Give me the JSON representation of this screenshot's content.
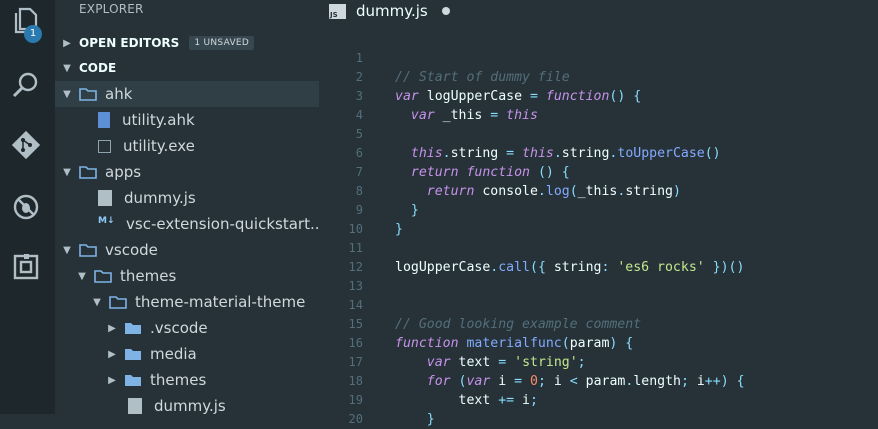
{
  "activity_bar": {
    "icons": [
      "files-icon",
      "search-icon",
      "git-icon",
      "debug-icon",
      "extensions-icon"
    ],
    "badge": "1"
  },
  "sidebar": {
    "title": "EXPLORER",
    "open_editors": {
      "label": "OPEN EDITORS",
      "badge": "1 UNSAVED"
    },
    "workspace": "CODE",
    "tree": [
      {
        "label": "ahk",
        "kind": "folder",
        "depth": 1,
        "open": true,
        "selected": true
      },
      {
        "label": "utility.ahk",
        "kind": "file-ahk",
        "depth": 2
      },
      {
        "label": "utility.exe",
        "kind": "file-exe",
        "depth": 2
      },
      {
        "label": "apps",
        "kind": "folder",
        "depth": 1,
        "open": true
      },
      {
        "label": "dummy.js",
        "kind": "file-js",
        "depth": 2
      },
      {
        "label": "vsc-extension-quickstart....",
        "kind": "file-md",
        "depth": 2
      },
      {
        "label": "vscode",
        "kind": "folder",
        "depth": 1,
        "open": true
      },
      {
        "label": "themes",
        "kind": "folder",
        "depth": 2,
        "open": true
      },
      {
        "label": "theme-material-theme",
        "kind": "folder",
        "depth": 3,
        "open": true
      },
      {
        "label": ".vscode",
        "kind": "folder-collapsed",
        "depth": 4
      },
      {
        "label": "media",
        "kind": "folder-collapsed",
        "depth": 4
      },
      {
        "label": "themes",
        "kind": "folder-collapsed",
        "depth": 4
      },
      {
        "label": "dummy.js",
        "kind": "file-js",
        "depth": 4
      }
    ]
  },
  "editor": {
    "tab": {
      "filename": "dummy.js",
      "icon_text": "JS",
      "dirty": true
    },
    "lines": [
      {
        "n": "1",
        "tokens": []
      },
      {
        "n": "2",
        "tokens": [
          {
            "t": "// Start of dummy file",
            "c": "comment"
          }
        ]
      },
      {
        "n": "3",
        "tokens": [
          {
            "t": "var ",
            "c": "keyword"
          },
          {
            "t": "logUpperCase",
            "c": "var"
          },
          {
            "t": " = ",
            "c": "op"
          },
          {
            "t": "function",
            "c": "keyword"
          },
          {
            "t": "() {",
            "c": "punct"
          }
        ]
      },
      {
        "n": "4",
        "tokens": [
          {
            "t": "  var ",
            "c": "keyword"
          },
          {
            "t": "_this",
            "c": "var"
          },
          {
            "t": " = ",
            "c": "op"
          },
          {
            "t": "this",
            "c": "keyword"
          }
        ]
      },
      {
        "n": "5",
        "tokens": []
      },
      {
        "n": "6",
        "tokens": [
          {
            "t": "  this",
            "c": "keyword"
          },
          {
            "t": ".",
            "c": "punct"
          },
          {
            "t": "string",
            "c": "var"
          },
          {
            "t": " = ",
            "c": "op"
          },
          {
            "t": "this",
            "c": "keyword"
          },
          {
            "t": ".",
            "c": "punct"
          },
          {
            "t": "string",
            "c": "var"
          },
          {
            "t": ".",
            "c": "punct"
          },
          {
            "t": "toUpperCase",
            "c": "func"
          },
          {
            "t": "()",
            "c": "punct"
          }
        ]
      },
      {
        "n": "7",
        "tokens": [
          {
            "t": "  return ",
            "c": "keyword"
          },
          {
            "t": "function ",
            "c": "keyword"
          },
          {
            "t": "() {",
            "c": "punct"
          }
        ]
      },
      {
        "n": "8",
        "tokens": [
          {
            "t": "    return ",
            "c": "keyword"
          },
          {
            "t": "console",
            "c": "var"
          },
          {
            "t": ".",
            "c": "punct"
          },
          {
            "t": "log",
            "c": "func"
          },
          {
            "t": "(",
            "c": "punct"
          },
          {
            "t": "_this",
            "c": "var"
          },
          {
            "t": ".",
            "c": "punct"
          },
          {
            "t": "string",
            "c": "var"
          },
          {
            "t": ")",
            "c": "punct"
          }
        ]
      },
      {
        "n": "9",
        "tokens": [
          {
            "t": "  }",
            "c": "punct"
          }
        ]
      },
      {
        "n": "10",
        "tokens": [
          {
            "t": "}",
            "c": "punct"
          }
        ]
      },
      {
        "n": "11",
        "tokens": []
      },
      {
        "n": "12",
        "tokens": [
          {
            "t": "logUpperCase",
            "c": "var"
          },
          {
            "t": ".",
            "c": "punct"
          },
          {
            "t": "call",
            "c": "func"
          },
          {
            "t": "({ ",
            "c": "punct"
          },
          {
            "t": "string",
            "c": "var"
          },
          {
            "t": ": ",
            "c": "punct"
          },
          {
            "t": "'es6 rocks'",
            "c": "str"
          },
          {
            "t": " })()",
            "c": "punct"
          }
        ]
      },
      {
        "n": "13",
        "tokens": []
      },
      {
        "n": "14",
        "tokens": []
      },
      {
        "n": "15",
        "tokens": [
          {
            "t": "// Good looking example comment",
            "c": "comment"
          }
        ]
      },
      {
        "n": "16",
        "tokens": [
          {
            "t": "function ",
            "c": "keyword"
          },
          {
            "t": "materialfunc",
            "c": "func"
          },
          {
            "t": "(",
            "c": "punct"
          },
          {
            "t": "param",
            "c": "param"
          },
          {
            "t": ") {",
            "c": "punct"
          }
        ]
      },
      {
        "n": "17",
        "tokens": [
          {
            "t": "    var ",
            "c": "keyword"
          },
          {
            "t": "text",
            "c": "var"
          },
          {
            "t": " = ",
            "c": "op"
          },
          {
            "t": "'string'",
            "c": "str"
          },
          {
            "t": ";",
            "c": "punct"
          }
        ]
      },
      {
        "n": "18",
        "tokens": [
          {
            "t": "    for ",
            "c": "keyword"
          },
          {
            "t": "(",
            "c": "punct"
          },
          {
            "t": "var ",
            "c": "keyword"
          },
          {
            "t": "i",
            "c": "var"
          },
          {
            "t": " = ",
            "c": "op"
          },
          {
            "t": "0",
            "c": "num"
          },
          {
            "t": "; ",
            "c": "punct"
          },
          {
            "t": "i",
            "c": "var"
          },
          {
            "t": " < ",
            "c": "op"
          },
          {
            "t": "param",
            "c": "var"
          },
          {
            "t": ".",
            "c": "punct"
          },
          {
            "t": "length",
            "c": "var"
          },
          {
            "t": "; ",
            "c": "punct"
          },
          {
            "t": "i",
            "c": "var"
          },
          {
            "t": "++",
            "c": "op"
          },
          {
            "t": ") {",
            "c": "punct"
          }
        ]
      },
      {
        "n": "19",
        "tokens": [
          {
            "t": "        text",
            "c": "var"
          },
          {
            "t": " += ",
            "c": "op"
          },
          {
            "t": "i",
            "c": "var"
          },
          {
            "t": ";",
            "c": "punct"
          }
        ]
      },
      {
        "n": "20",
        "tokens": [
          {
            "t": "    }",
            "c": "punct"
          }
        ]
      }
    ]
  },
  "colors": {
    "editor_bg": "#263238",
    "activity_bg": "#1e272c",
    "selection_bg": "#303f46",
    "folder": "#7fb3e6",
    "badge": "#2a7ab0"
  }
}
